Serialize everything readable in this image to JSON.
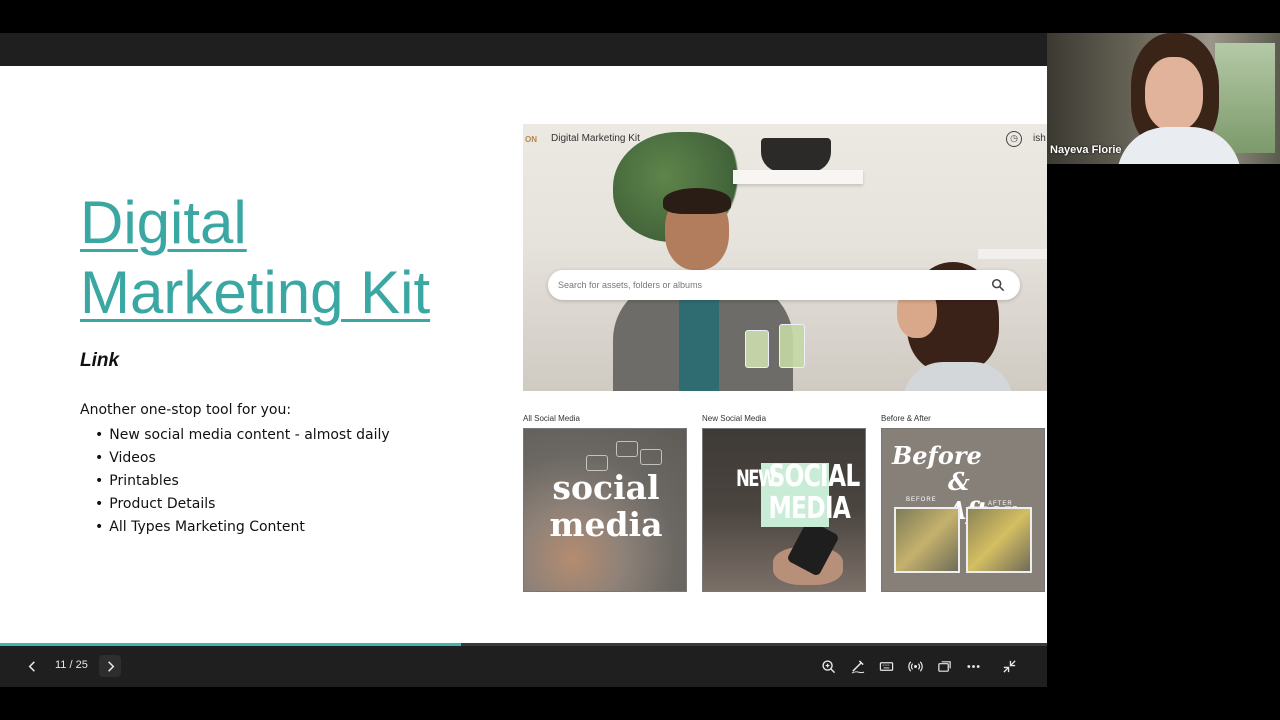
{
  "slide": {
    "title": "Digital Marketing Kit",
    "link_label": "Link",
    "intro": "Another one-stop tool for you:",
    "bullets": [
      "New social media content - almost daily",
      "Videos",
      "Printables",
      "Product Details",
      "All Types Marketing Content"
    ]
  },
  "embedded": {
    "logo_fragment": "ON",
    "nav_title": "Digital Marketing Kit",
    "nav_fragment": "ish",
    "search_placeholder": "Search for assets, folders or albums",
    "cards": [
      {
        "caption": "All Social Media",
        "line1": "social",
        "line2": "media"
      },
      {
        "caption": "New Social Media",
        "word_new": "NEW",
        "word_social": "SOCIAL",
        "word_media": "MEDIA"
      },
      {
        "caption": "Before & After",
        "line1": "Before",
        "line2": "& After",
        "label_before": "BEFORE",
        "label_after": "AFTER"
      }
    ]
  },
  "presenter": {
    "name": "Nayeva Florie"
  },
  "toolbar": {
    "current_slide": 11,
    "total_slides": 25,
    "counter": "11 / 25",
    "icons": [
      "prev-icon",
      "next-icon",
      "zoom-icon",
      "pen-icon",
      "keyboard-icon",
      "broadcast-icon",
      "window-icon",
      "more-icon",
      "exit-fullscreen-icon"
    ]
  },
  "colors": {
    "title_teal": "#3aa7a3",
    "progress_teal": "#3fb5b0",
    "toolbar_bg": "#1f1f1f"
  }
}
